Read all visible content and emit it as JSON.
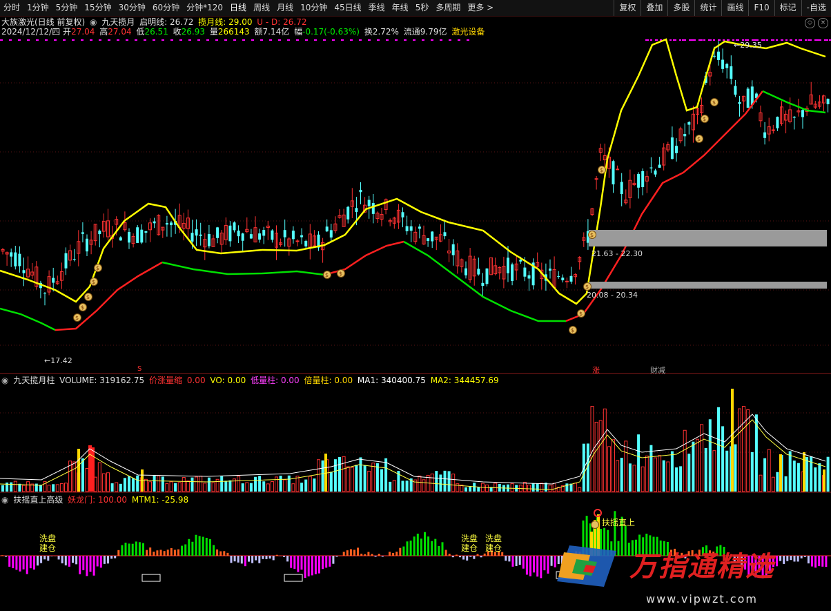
{
  "toolbar": {
    "periods": [
      "分时",
      "1分钟",
      "5分钟",
      "15分钟",
      "30分钟",
      "60分钟",
      "分钟*120",
      "日线",
      "周线",
      "月线",
      "10分钟",
      "45日线",
      "季线",
      "年线",
      "5秒",
      "多周期",
      "更多 >"
    ],
    "active": "日线",
    "right": [
      "复权",
      "叠加",
      "多股",
      "统计",
      "画线",
      "F10",
      "标记",
      "-自选"
    ]
  },
  "main": {
    "title": "大族激光(日线 前复权)",
    "indicator": "九天揽月",
    "qiming_label": "启明线:",
    "qiming_value": "26.72",
    "lanyue_label": "揽月线:",
    "lanyue_value": "29.00",
    "ud_label": "U - D:",
    "ud_value": "26.72",
    "date": "2024/12/12/四",
    "open_label": "开",
    "open": "27.04",
    "high_label": "高",
    "high": "27.04",
    "low_label": "低",
    "low": "26.51",
    "close_label": "收",
    "close": "26.93",
    "vol_label": "量",
    "vol": "266143",
    "amt_label": "额",
    "amt": "7.14亿",
    "chg_label": "幅",
    "chg": "-0.17(-0.63%)",
    "turnover_label": "换",
    "turnover": "2.72%",
    "float_label": "流通",
    "float": "9.79亿",
    "concept": "激光设备",
    "max_label": "29.35",
    "min_label": "17.42",
    "zone1_label": "21.63 - 22.30",
    "zone2_label": "20.08 - 20.34",
    "sig_s": "S",
    "sig_zhang": "涨",
    "sig_caijian": "财减"
  },
  "volume": {
    "title": "九天揽月柱",
    "volume_label": "VOLUME:",
    "volume_value": "319162.75",
    "jzlw_label": "价涨量缩",
    "jzlw_value": "0.00",
    "vo_label": "VO:",
    "vo_value": "0.00",
    "dlz_label": "低量柱:",
    "dlz_value": "0.00",
    "blz_label": "倍量柱:",
    "blz_value": "0.00",
    "ma1_label": "MA1:",
    "ma1_value": "340400.75",
    "ma2_label": "MA2:",
    "ma2_value": "344457.69"
  },
  "osc": {
    "title": "扶摇直上高级",
    "ylm_label": "妖龙门:",
    "ylm_value": "100.00",
    "mtm_label": "MTM1:",
    "mtm_value": "-25.98",
    "xipan": "洗盘",
    "jiancang": "建仓",
    "fyzs": "扶摇直上"
  },
  "watermark": {
    "text": "万指通精选",
    "url": "www.vipwzt.com"
  },
  "colors": {
    "up": "#ff3232",
    "down": "#54ffff",
    "yellow": "#ffff00",
    "green": "#00e000",
    "red": "#ff2020",
    "magenta": "#ff00ff",
    "gold": "#ffd700"
  }
}
